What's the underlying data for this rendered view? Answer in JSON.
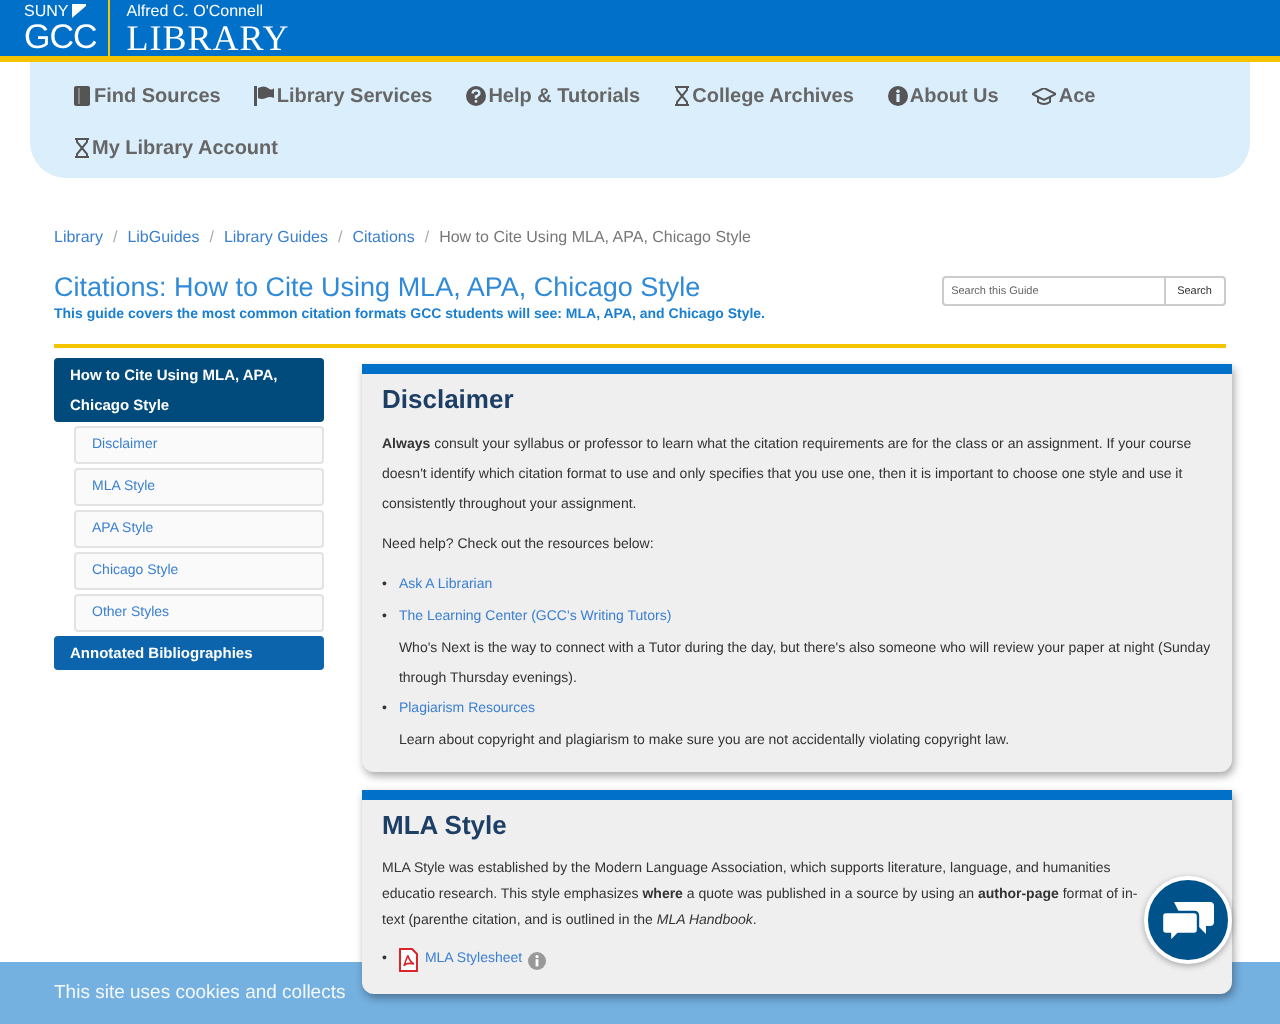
{
  "header": {
    "suny": "SUNY",
    "gcc": "GCC",
    "library_owner": "Alfred C. O'Connell",
    "library_word": "LIBRARY"
  },
  "nav": [
    {
      "label": "Find Sources",
      "kind": "book"
    },
    {
      "label": "Library Services",
      "kind": "flag"
    },
    {
      "label": "Help & Tutorials",
      "kind": "question"
    },
    {
      "label": "College Archives",
      "kind": "hourglass"
    },
    {
      "label": "About Us",
      "kind": "info"
    },
    {
      "label": "Ace",
      "kind": "cap"
    },
    {
      "label": "My Library Account",
      "kind": "hourglass"
    }
  ],
  "breadcrumb": [
    {
      "label": "Library",
      "kind": "link"
    },
    {
      "label": "/",
      "kind": "separator"
    },
    {
      "label": "LibGuides",
      "kind": "link"
    },
    {
      "label": "/",
      "kind": "separator"
    },
    {
      "label": "Library Guides",
      "kind": "link"
    },
    {
      "label": "/",
      "kind": "separator"
    },
    {
      "label": "Citations",
      "kind": "link"
    },
    {
      "label": "/",
      "kind": "separator"
    },
    {
      "label": "How to Cite Using MLA, APA, Chicago Style",
      "kind": "current"
    }
  ],
  "guide": {
    "title": "Citations: How to Cite Using MLA, APA, Chicago Style",
    "subtitle": "This guide covers the most common citation formats GCC students will see: MLA, APA, and Chicago Style."
  },
  "search": {
    "placeholder": "Search this Guide",
    "button": "Search"
  },
  "sidebar": [
    {
      "label": "How to Cite Using MLA, APA, Chicago Style",
      "selected": true,
      "children": [
        {
          "label": "Disclaimer",
          "selected": false
        },
        {
          "label": "MLA Style",
          "selected": false
        },
        {
          "label": "APA Style",
          "selected": false
        },
        {
          "label": "Chicago Style",
          "selected": false
        },
        {
          "label": "Other Styles",
          "selected": false
        }
      ]
    },
    {
      "label": "Annotated Bibliographies",
      "selected": false
    }
  ],
  "sections": [
    {
      "title": "Disclaimer",
      "paragraphs": [
        "**Always** consult your syllabus or professor to learn what the citation requirements are for the class or an assignment. If your course doesn't identify which citation format to use and only specifies that you use one, then it is important to choose one style and use it consistently throughout your assignment.",
        "Need help? Check out the resources below:"
      ],
      "links": [
        {
          "bullet": "•",
          "label": "Ask A Librarian",
          "kind": "plain"
        },
        {
          "bullet": "•",
          "label": "The Learning Center (GCC's Writing Tutors)",
          "kind": "plain",
          "description": "Who's Next is the way to connect with a Tutor during the day, but there's also someone who will review your paper at night (Sunday through Thursday evenings)."
        },
        {
          "bullet": "•",
          "label": "Plagiarism Resources",
          "kind": "plain",
          "description": "Learn about copyright and plagiarism to make sure you are not accidentally violating copyright law."
        }
      ]
    },
    {
      "title": "MLA Style",
      "paragraphs": [
        "MLA Style was established by the Modern Language Association, which supports literature, language, and humanities educatio research. This style emphasizes **where** a quote was published in a source by using an **author-page** format of in-text (parenthe citation, and is outlined in the *MLA Handbook*."
      ],
      "links": [
        {
          "bullet": "•",
          "label": "MLA Stylesheet",
          "kind": "pdf"
        }
      ]
    }
  ],
  "cookie_banner": {
    "text": "This site uses cookies and collects"
  }
}
